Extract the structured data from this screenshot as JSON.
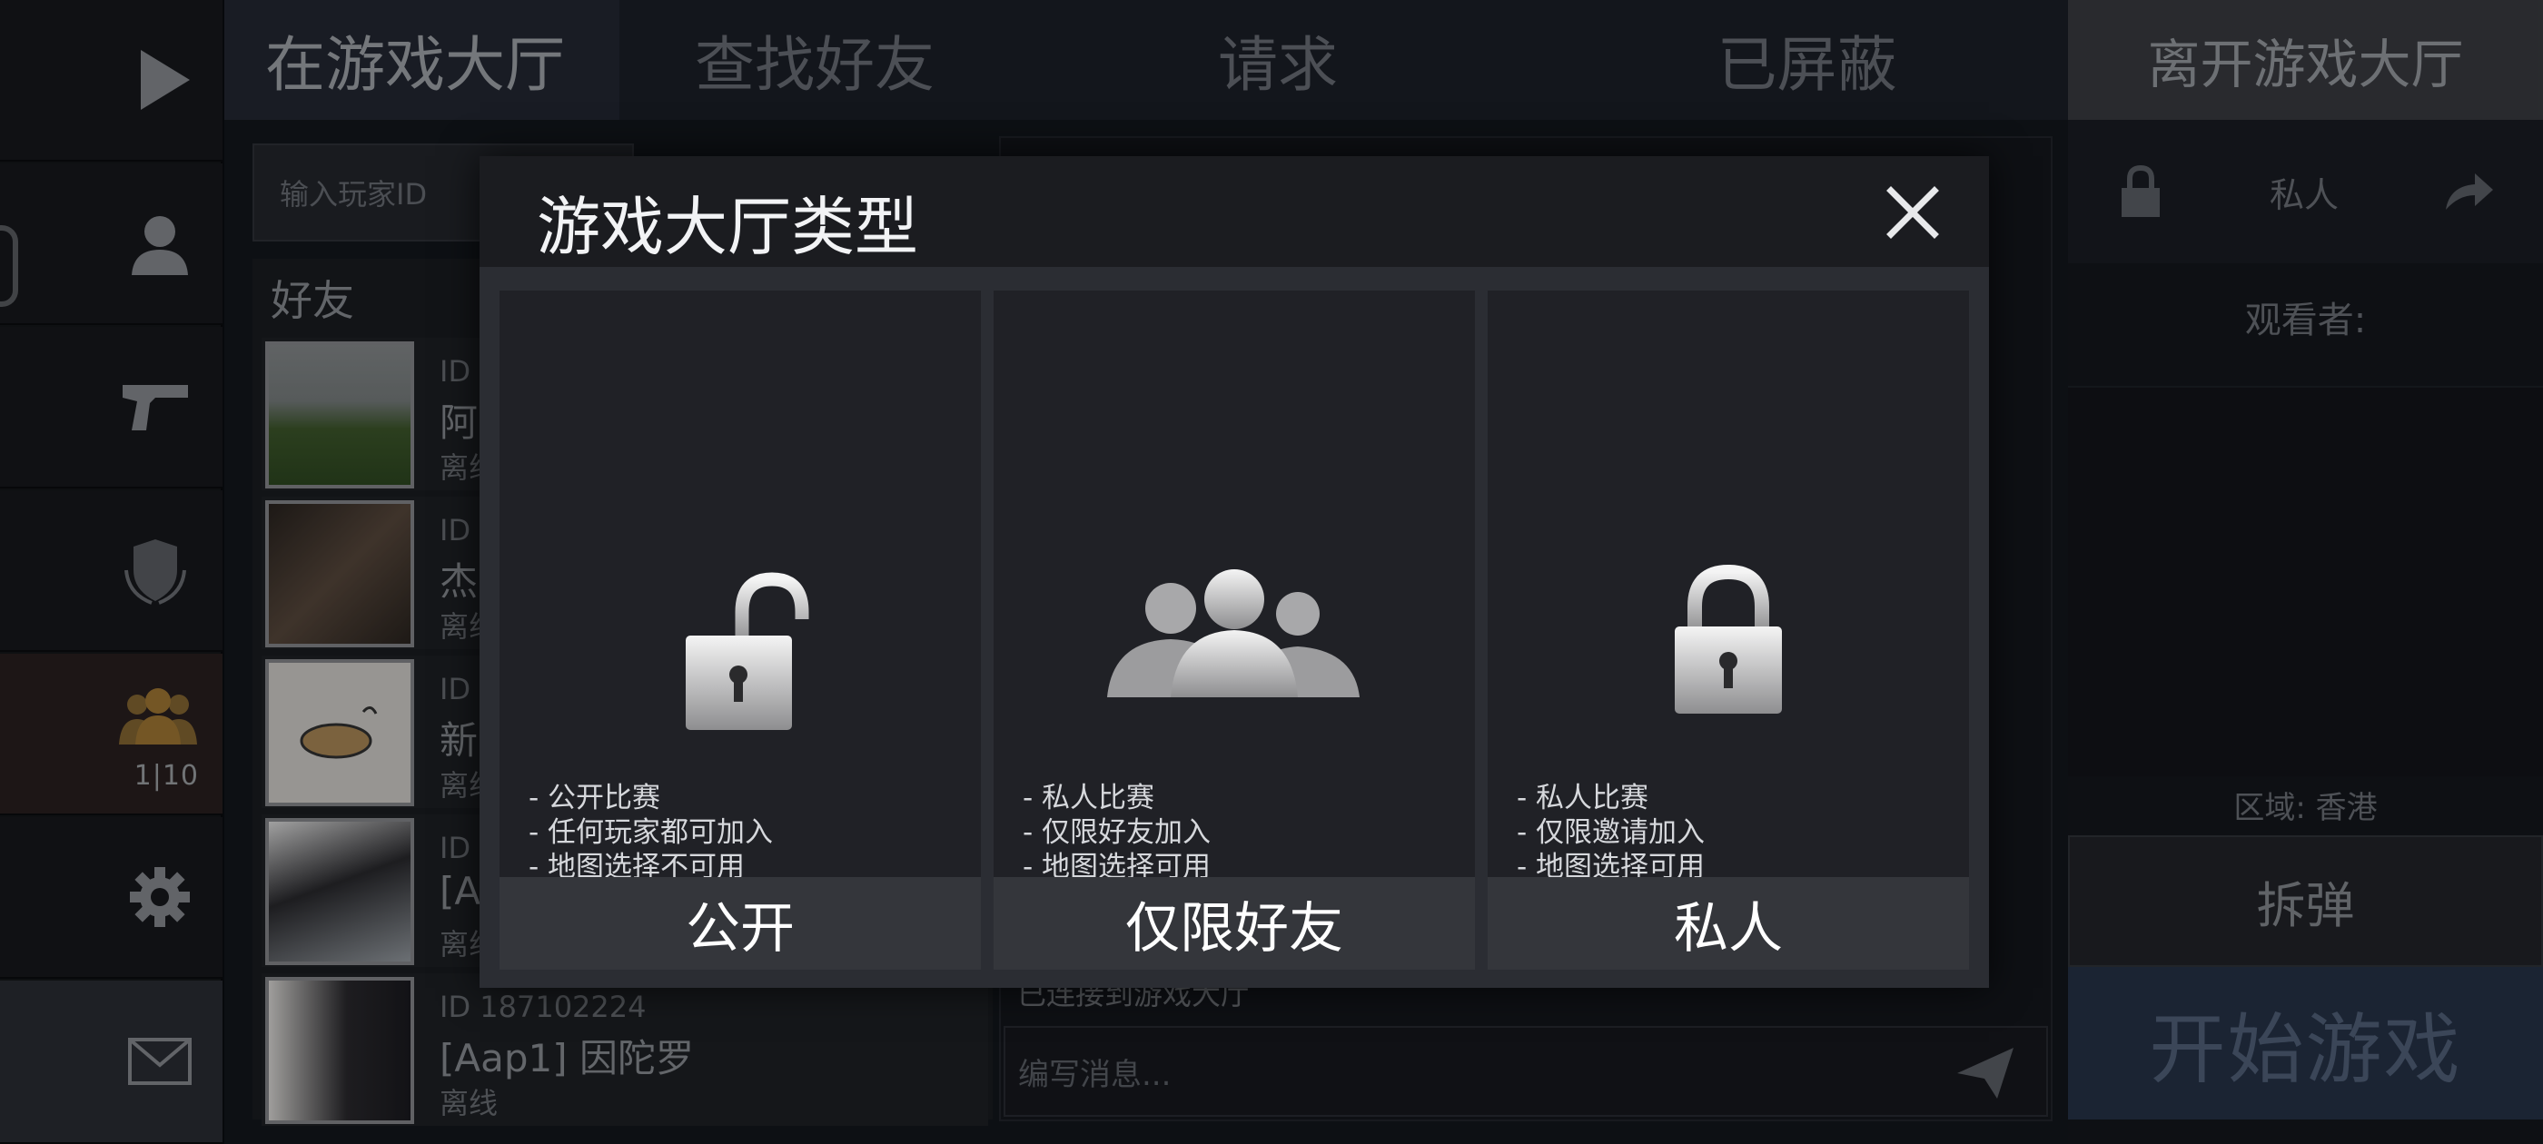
{
  "tabs": [
    {
      "label": "在游戏大厅",
      "active": true
    },
    {
      "label": "查找好友",
      "active": false
    },
    {
      "label": "请求",
      "active": false
    },
    {
      "label": "已屏蔽",
      "active": false
    }
  ],
  "leave_button": "离开游戏大厅",
  "sidebar": {
    "items": [
      {
        "icon": "play-icon"
      },
      {
        "icon": "profile-icon"
      },
      {
        "icon": "pistol-icon"
      },
      {
        "icon": "rank-shield-icon"
      },
      {
        "icon": "party-icon",
        "count": "1|10"
      },
      {
        "icon": "gear-icon"
      },
      {
        "icon": "mail-icon"
      }
    ]
  },
  "search": {
    "placeholder": "输入玩家ID"
  },
  "friends": {
    "title": "好友",
    "items": [
      {
        "id": "ID",
        "name": "阿",
        "status": "离线"
      },
      {
        "id": "ID",
        "name": "杰",
        "status": "离线"
      },
      {
        "id": "ID",
        "name": "新",
        "status": "离线"
      },
      {
        "id": "ID",
        "name": "[A",
        "status": "离线"
      },
      {
        "id": "ID 187102224",
        "name": "[Aap1] 因陀罗",
        "status": "离线"
      }
    ]
  },
  "chat": {
    "system_line": "已连接到游戏大厅",
    "input_placeholder": "编写消息..."
  },
  "right_panel": {
    "privacy": "私人",
    "watchers_label": "观看者:",
    "region": "区域: 香港",
    "mode": "拆弹",
    "start_button": "开始游戏"
  },
  "modal": {
    "title": "游戏大厅类型",
    "options": [
      {
        "icon": "unlocked-padlock-icon",
        "desc": "- 公开比赛\n- 任何玩家都可加入\n- 地图选择不可用",
        "label": "公开"
      },
      {
        "icon": "friends-group-icon",
        "desc": "- 私人比赛\n- 仅限好友加入\n- 地图选择可用",
        "label": "仅限好友"
      },
      {
        "icon": "locked-padlock-icon",
        "desc": "- 私人比赛\n- 仅限邀请加入\n- 地图选择可用",
        "label": "私人"
      }
    ]
  },
  "colors": {
    "modal_bg": "#2b2d33",
    "option_bg": "#202126",
    "option_label_bg": "#34363b",
    "start_button_bg": "#27344a"
  }
}
